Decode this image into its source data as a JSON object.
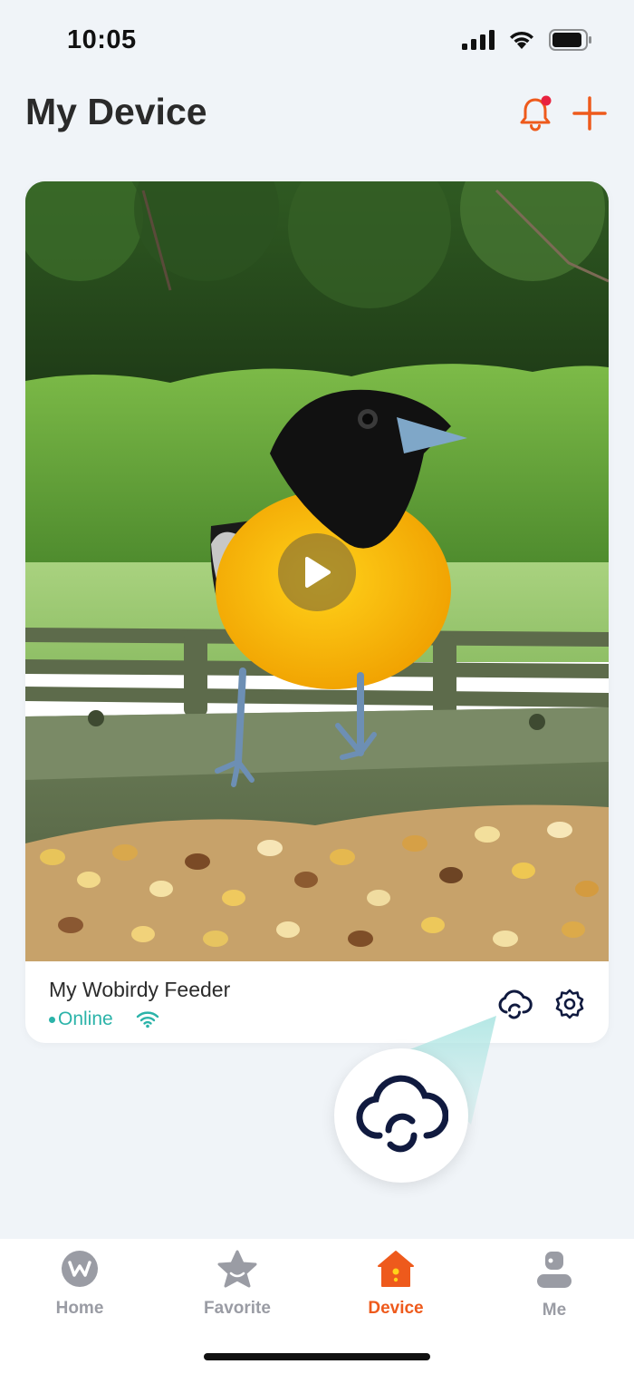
{
  "status_bar": {
    "time": "10:05"
  },
  "header": {
    "title": "My Device"
  },
  "device": {
    "name": "My Wobirdy Feeder",
    "status": "Online"
  },
  "tabs": [
    {
      "label": "Home",
      "icon": "home-w-icon"
    },
    {
      "label": "Favorite",
      "icon": "star-icon"
    },
    {
      "label": "Device",
      "icon": "birdhouse-icon"
    },
    {
      "label": "Me",
      "icon": "person-icon"
    }
  ],
  "active_tab": "Device",
  "colors": {
    "accent": "#ee5a1c",
    "online": "#2bb3a9",
    "navy": "#101a3f",
    "inactive": "#9a9ca4",
    "background": "#f0f4f8"
  }
}
